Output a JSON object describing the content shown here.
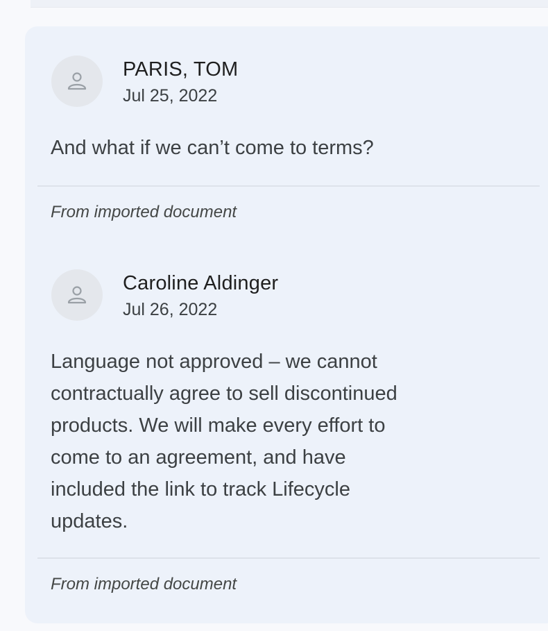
{
  "comments": [
    {
      "author": "PARIS, TOM",
      "date": "Jul 25, 2022",
      "body": "And what if we can’t come to terms?",
      "source": "From imported document",
      "avatar_icon": "person-icon"
    },
    {
      "author": "Caroline Aldinger",
      "date": "Jul 26, 2022",
      "body_lines": [
        "Language not approved – we cannot",
        "contractually agree to sell discontinued",
        "products. We will make every effort to",
        "come to an agreement, and have",
        "included the link to track Lifecycle",
        "updates."
      ],
      "source": "From imported document",
      "avatar_icon": "person-icon"
    }
  ],
  "colors": {
    "card_background": "#edf2fa",
    "avatar_background": "#e4e7ec",
    "text_primary": "#1f1f1f",
    "text_secondary": "#3c4043"
  }
}
